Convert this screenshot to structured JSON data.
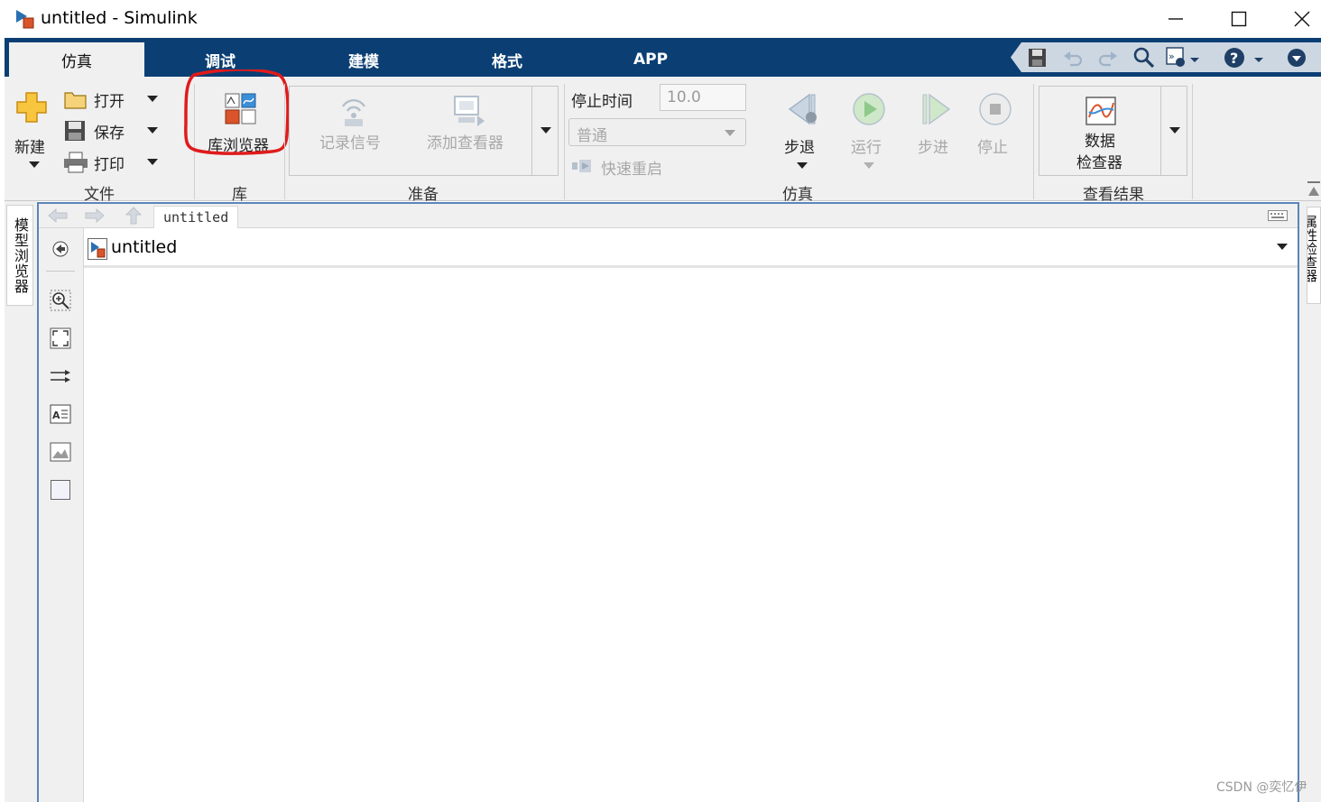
{
  "window": {
    "title": "untitled - Simulink"
  },
  "tabs": [
    {
      "label": "仿真",
      "active": true
    },
    {
      "label": "调试",
      "active": false
    },
    {
      "label": "建模",
      "active": false
    },
    {
      "label": "格式",
      "active": false
    },
    {
      "label": "APP",
      "active": false
    }
  ],
  "quick_access": [
    "save-icon",
    "undo-icon",
    "redo-icon",
    "search-icon",
    "shortcut-icon",
    "help-icon",
    "minimize-ribbon-icon"
  ],
  "ribbon": {
    "file": {
      "new": "新建",
      "open": "打开",
      "save": "保存",
      "print": "打印",
      "group": "文件"
    },
    "library": {
      "browser": "库浏览器",
      "group": "库"
    },
    "prepare": {
      "log_signals": "记录信号",
      "add_viewer": "添加查看器",
      "group": "准备"
    },
    "simulate": {
      "stop_time_label": "停止时间",
      "stop_time_value": "10.0",
      "mode": "普通",
      "fast_restart": "快速重启",
      "step_back": "步退",
      "run": "运行",
      "step_forward": "步进",
      "stop": "停止",
      "group": "仿真"
    },
    "review": {
      "data_inspector_line1": "数据",
      "data_inspector_line2": "检查器",
      "group": "查看结果"
    }
  },
  "editor": {
    "left_tab": "模型浏览器",
    "right_tab": "属性检查器",
    "breadcrumb": "untitled",
    "address": "untitled"
  },
  "watermark": "CSDN @奕忆伊",
  "colors": {
    "tab_bar": "#0b3f74",
    "highlight": "#e01b1b",
    "canvas_border": "#5b84b8"
  }
}
